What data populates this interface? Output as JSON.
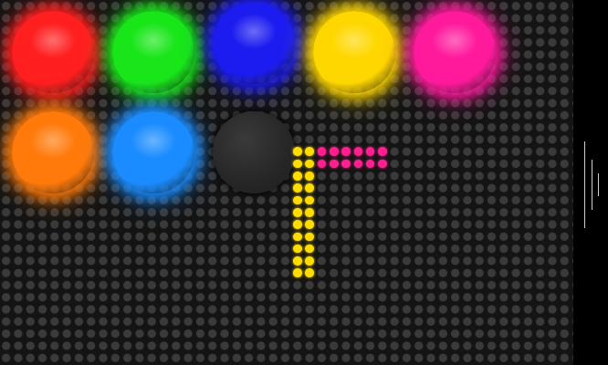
{
  "palette": [
    {
      "id": "red",
      "color": "#ff1f1f",
      "selected": false
    },
    {
      "id": "green",
      "color": "#19e619",
      "selected": false
    },
    {
      "id": "blue",
      "color": "#1c1cf0",
      "selected": false
    },
    {
      "id": "yellow",
      "color": "#ffd700",
      "selected": false
    },
    {
      "id": "pink",
      "color": "#ff1a9c",
      "selected": false
    },
    {
      "id": "orange",
      "color": "#ff7a0a",
      "selected": false
    },
    {
      "id": "cyan",
      "color": "#1a8cff",
      "selected": false
    },
    {
      "id": "eraser",
      "color": "#2a2a2a",
      "selected": false
    }
  ],
  "drawing": {
    "colors": {
      "yellow": "#ffdd00",
      "pink": "#ff1f8f"
    },
    "off_dot_color": "#3a3a3a"
  }
}
